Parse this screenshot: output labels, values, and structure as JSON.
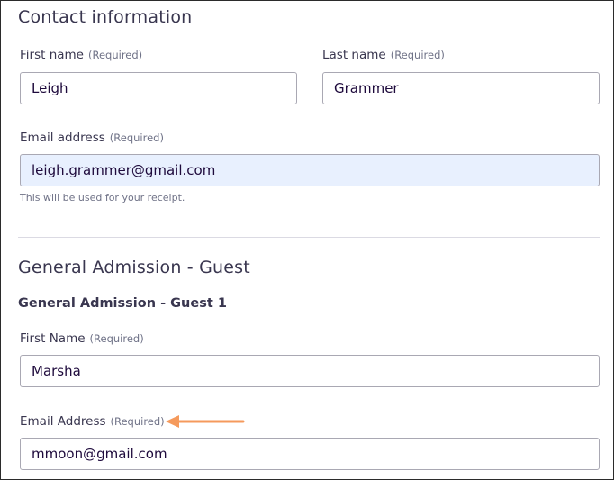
{
  "contact": {
    "title": "Contact information",
    "first_name": {
      "label": "First name",
      "required": "(Required)",
      "value": "Leigh"
    },
    "last_name": {
      "label": "Last name",
      "required": "(Required)",
      "value": "Grammer"
    },
    "email": {
      "label": "Email address",
      "required": "(Required)",
      "value": "leigh.grammer@gmail.com",
      "hint": "This will be used for your receipt."
    }
  },
  "ticket": {
    "title": "General Admission - Guest",
    "guest_title": "General Admission - Guest 1",
    "first_name": {
      "label": "First Name",
      "required": "(Required)",
      "value": "Marsha"
    },
    "email": {
      "label": "Email Address",
      "required": "(Required)",
      "value": "mmoon@gmail.com"
    }
  },
  "annotation": {
    "arrow_color": "#f59a5c",
    "arrow_icon": "arrow-left-icon"
  }
}
